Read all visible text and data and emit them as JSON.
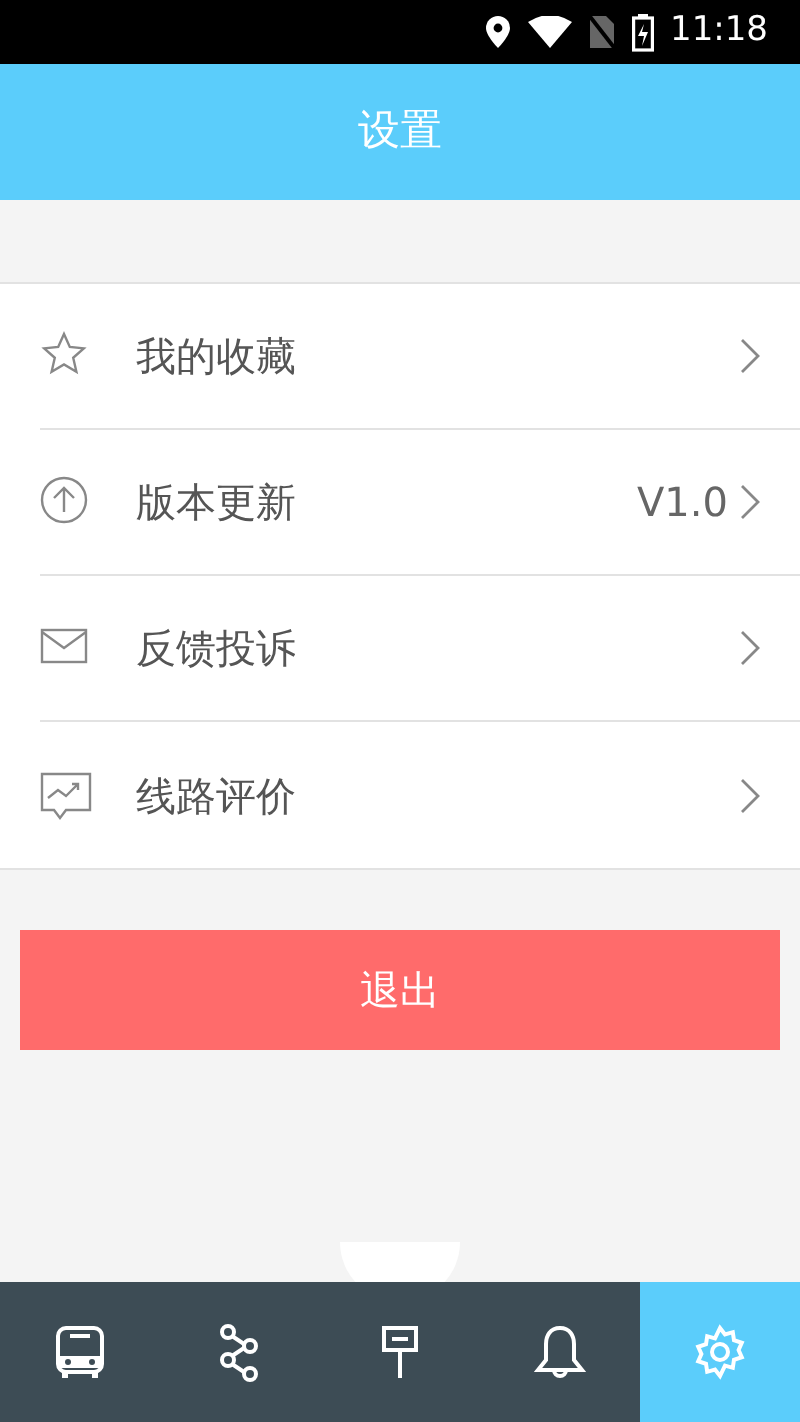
{
  "status_bar": {
    "time": "11:18"
  },
  "header": {
    "title": "设置"
  },
  "menu": [
    {
      "label": "我的收藏"
    },
    {
      "label": "版本更新",
      "value": "V1.0"
    },
    {
      "label": "反馈投诉"
    },
    {
      "label": "线路评价"
    }
  ],
  "logout_button": "退出",
  "tabs": [
    {
      "selected": false
    },
    {
      "selected": false
    },
    {
      "selected": false
    },
    {
      "selected": false
    },
    {
      "selected": true
    }
  ]
}
